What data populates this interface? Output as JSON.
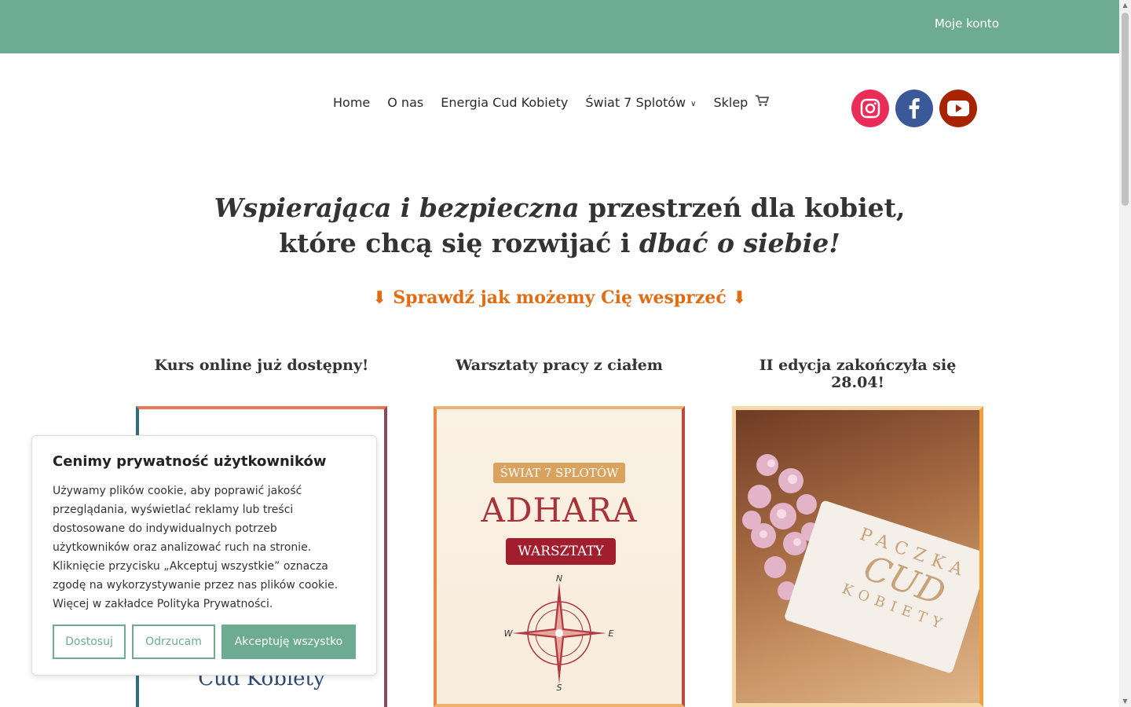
{
  "topbar": {
    "account_label": "Moje konto"
  },
  "nav": {
    "items": [
      {
        "label": "Home"
      },
      {
        "label": "O nas"
      },
      {
        "label": "Energia Cud Kobiety"
      },
      {
        "label": "Świat 7 Splotów"
      },
      {
        "label": "Sklep"
      }
    ]
  },
  "social": [
    "instagram-icon",
    "facebook-icon",
    "youtube-icon"
  ],
  "hero": {
    "line1_em": "Wspierająca i bezpieczna",
    "line1_rest": " przestrzeń dla kobiet,",
    "line2_rest": "które chcą się rozwijać i ",
    "line2_em": "dbać o siebie!",
    "cta": "⬇ Sprawdź jak możemy Cię wesprzeć ⬇"
  },
  "cards": [
    {
      "title": "Kurs online już dostępny!",
      "image_text": "Cud Kobiety"
    },
    {
      "title": "Warsztaty pracy z ciałem",
      "badge": "ŚWIAT 7 SPLOTÓW",
      "name": "ADHARA",
      "sub": "WARSZTATY",
      "compass": {
        "n": "N",
        "e": "E",
        "s": "S",
        "w": "W"
      }
    },
    {
      "title": "II edycja zakończyła się 28.04!",
      "tag_l1": "PACZKA",
      "tag_l2": "CUD",
      "tag_l3": "KOBIETY"
    }
  ],
  "cookie": {
    "title": "Cenimy prywatność użytkowników",
    "body": "Używamy plików cookie, aby poprawić jakość przeglądania, wyświetlać reklamy lub treści dostosowane do indywidualnych potrzeb użytkowników oraz analizować ruch na stronie. Kliknięcie przycisku „Akceptuj wszystkie” oznacza zgodę na wykorzystywanie przez nas plików cookie. Więcej w zakładce Polityka Prywatności.",
    "btn_customize": "Dostosuj",
    "btn_reject": "Odrzucam",
    "btn_accept": "Akceptuję wszystko"
  }
}
